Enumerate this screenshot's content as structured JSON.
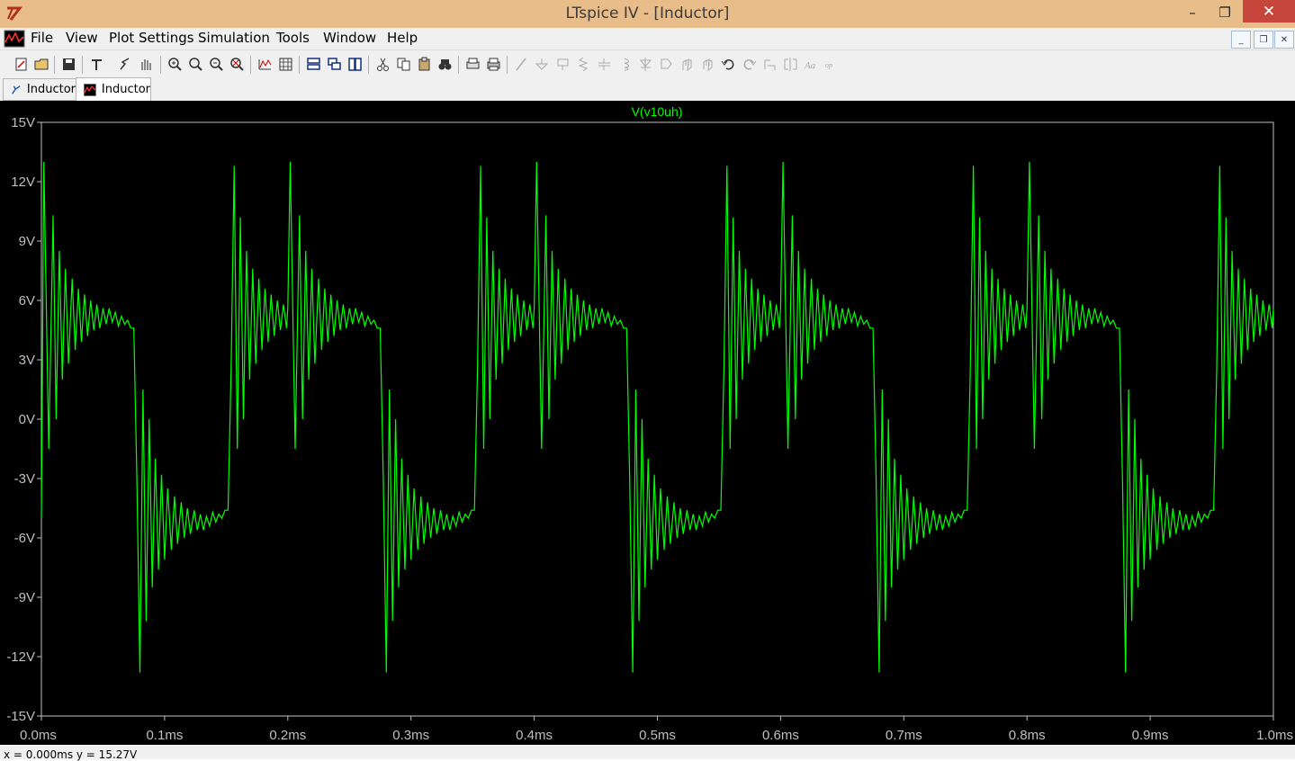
{
  "window": {
    "title": "LTspice IV - [Inductor]"
  },
  "title_controls": {
    "minimize": "–",
    "maximize": "❐",
    "close": "✕"
  },
  "menu": {
    "items": [
      {
        "label": "File"
      },
      {
        "label": "View"
      },
      {
        "label": "Plot Settings"
      },
      {
        "label": "Simulation"
      },
      {
        "label": "Tools"
      },
      {
        "label": "Window"
      },
      {
        "label": "Help"
      }
    ],
    "mdi": {
      "minimize": "_",
      "restore": "❐",
      "close": "✕"
    }
  },
  "toolbar": {
    "icons": [
      "new-schematic-icon",
      "open-icon",
      "save-icon",
      "control-panel-icon",
      "run-icon",
      "halt-icon",
      "zoom-in-icon",
      "zoom-area-icon",
      "zoom-out-icon",
      "zoom-cancel-icon",
      "autorange-icon",
      "grid-icon",
      "tile-horizontal-icon",
      "cascade-icon",
      "tile-vertical-icon",
      "cut-icon",
      "copy-icon",
      "paste-icon",
      "find-icon",
      "print-preview-icon",
      "print-icon",
      "wire-icon",
      "ground-icon",
      "label-icon",
      "resistor-icon",
      "capacitor-icon",
      "inductor-icon",
      "diode-icon",
      "component-icon",
      "move-icon",
      "drag-icon",
      "undo-icon",
      "redo-icon",
      "rotate-icon",
      "mirror-icon",
      "text-icon",
      "spice-directive-icon"
    ]
  },
  "tabs": [
    {
      "label": "Inductor",
      "icon": "schematic-icon",
      "active": false
    },
    {
      "label": "Inductor",
      "icon": "waveform-icon",
      "active": true
    }
  ],
  "colors": {
    "trace": "#00ff00",
    "plot_bg": "#000000",
    "axis": "#bfbfbf",
    "tick_text": "#bfbfbf"
  },
  "chart_data": {
    "type": "line",
    "title": "V(v10uh)",
    "xlabel": "",
    "ylabel": "",
    "xlim": [
      0.0,
      1.0
    ],
    "ylim": [
      -15,
      15
    ],
    "x_unit": "ms",
    "x_ticks": [
      "0.0ms",
      "0.1ms",
      "0.2ms",
      "0.3ms",
      "0.4ms",
      "0.5ms",
      "0.6ms",
      "0.7ms",
      "0.8ms",
      "0.9ms",
      "1.0ms"
    ],
    "y_ticks": [
      "15V",
      "12V",
      "9V",
      "6V",
      "3V",
      "0V",
      "-3V",
      "-6V",
      "-9V",
      "-12V",
      "-15V"
    ],
    "y_tick_values": [
      15,
      12,
      9,
      6,
      3,
      0,
      -3,
      -6,
      -9,
      -12,
      -15
    ],
    "x_tick_values": [
      0.0,
      0.1,
      0.2,
      0.3,
      0.4,
      0.5,
      0.6,
      0.7,
      0.8,
      0.9,
      1.0
    ],
    "grid": false,
    "series": [
      {
        "name": "V(v10uh)",
        "x": [
          0.0,
          0.002,
          0.006,
          0.0095,
          0.012,
          0.0145,
          0.017,
          0.0195,
          0.022,
          0.025,
          0.0275,
          0.03,
          0.0325,
          0.035,
          0.0375,
          0.04,
          0.0425,
          0.045,
          0.0475,
          0.05,
          0.0525,
          0.055,
          0.0575,
          0.06,
          0.0625,
          0.065,
          0.0675,
          0.07,
          0.0725,
          0.075,
          0.0775,
          0.08,
          0.0825,
          0.085,
          0.0875,
          0.09,
          0.0925,
          0.095,
          0.0975,
          0.1,
          0.1025,
          0.1055,
          0.108,
          0.1105,
          0.1135,
          0.116,
          0.1185,
          0.121,
          0.124,
          0.1265,
          0.129,
          0.1315,
          0.134,
          0.1365,
          0.139,
          0.1415,
          0.144,
          0.1465,
          0.149,
          0.1515,
          0.154,
          0.1565,
          0.159,
          0.1615,
          0.164,
          0.1665,
          0.169,
          0.1715,
          0.174,
          0.1765,
          0.179,
          0.1815,
          0.184,
          0.1865,
          0.189,
          0.1915,
          0.194,
          0.1965,
          0.199,
          0.2
        ],
        "y": [
          -5.0,
          13.0,
          -1.5,
          10.3,
          0.0,
          8.5,
          2.0,
          7.6,
          2.8,
          7.1,
          3.5,
          6.6,
          3.9,
          6.3,
          4.2,
          6.0,
          4.5,
          5.8,
          4.6,
          5.6,
          4.8,
          5.6,
          4.9,
          5.4,
          4.7,
          5.2,
          4.8,
          5.0,
          4.6,
          4.6,
          -3.0,
          -12.8,
          1.5,
          -10.2,
          0.0,
          -8.5,
          -2.0,
          -7.6,
          -2.8,
          -7.1,
          -3.5,
          -6.6,
          -3.9,
          -6.3,
          -4.2,
          -6.0,
          -4.5,
          -5.8,
          -4.6,
          -5.6,
          -4.8,
          -5.6,
          -4.9,
          -5.4,
          -4.7,
          -5.2,
          -4.8,
          -5.0,
          -4.6,
          -4.6,
          2.5,
          12.8,
          -1.5,
          10.2,
          0.0,
          8.5,
          2.0,
          7.6,
          2.8,
          7.1,
          3.5,
          6.6,
          3.9,
          6.3,
          4.2,
          6.0,
          4.5,
          5.8,
          4.6,
          5.6
        ]
      }
    ]
  },
  "status_bar": {
    "text": "x = 0.000ms   y = 15.27V"
  }
}
